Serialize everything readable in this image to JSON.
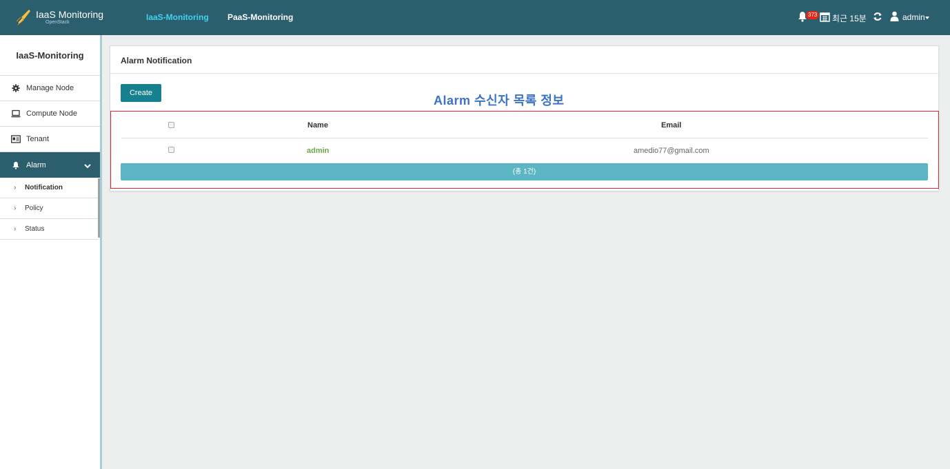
{
  "header": {
    "logo_title": "IaaS Monitoring",
    "logo_subtitle": "OpenStack",
    "tabs": [
      {
        "label": "IaaS-Monitoring",
        "active": true
      },
      {
        "label": "PaaS-Monitoring",
        "active": false
      }
    ],
    "alarm_count": "373",
    "time_range": "최근 15분",
    "user": "admin"
  },
  "sidebar": {
    "title": "IaaS-Monitoring",
    "items": [
      {
        "label": "Manage Node",
        "icon": "gear-icon"
      },
      {
        "label": "Compute Node",
        "icon": "laptop-icon"
      },
      {
        "label": "Tenant",
        "icon": "id-card-icon"
      },
      {
        "label": "Alarm",
        "icon": "bell-icon",
        "expanded": true
      }
    ],
    "sub_items": [
      {
        "label": "Notification",
        "active": true
      },
      {
        "label": "Policy",
        "active": false
      },
      {
        "label": "Status",
        "active": false
      }
    ]
  },
  "panel": {
    "title": "Alarm Notification",
    "create_label": "Create",
    "annotation": "Alarm  수신자 목록 정보"
  },
  "table": {
    "columns": [
      "Name",
      "Email"
    ],
    "rows": [
      {
        "name": "admin",
        "email": "amedio77@gmail.com"
      }
    ],
    "total_label": "(총 1건)"
  },
  "colors": {
    "topbar": "#2c5f6e",
    "active_tab": "#3fd2f0",
    "create_button": "#17808e",
    "total_bar": "#5cb5c2",
    "annotation": "#3b73c4",
    "highlight_box": "#e0262c",
    "name_link": "#71a84a"
  }
}
